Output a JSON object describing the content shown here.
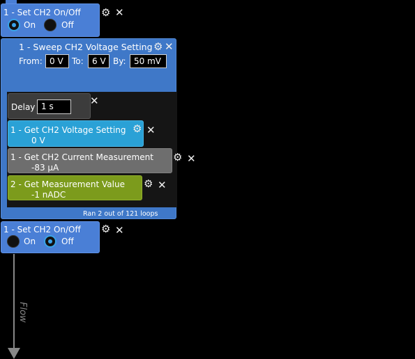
{
  "block1": {
    "title": "1 - Set CH2 On/Off",
    "on_label": "On",
    "off_label": "Off",
    "selected": "On",
    "gear_icon": "gear-icon",
    "close_icon": "close-icon"
  },
  "sweep": {
    "title": "1 - Sweep CH2 Voltage Setting",
    "from_label": "From:",
    "from_value": "0 V",
    "to_label": "To:",
    "to_value": "6 V",
    "by_label": "By:",
    "by_value": "50 mV",
    "status": "Ran 2 out of 121 loops"
  },
  "delay": {
    "label": "Delay",
    "value": "1 s"
  },
  "get_voltage": {
    "title": "1 - Get CH2 Voltage Setting",
    "value": "0 V",
    "color": "#2aa1d6"
  },
  "get_current": {
    "title": "1 - Get CH2 Current Measurement",
    "value": "-83 μA",
    "color": "#6e6e6e"
  },
  "get_measure": {
    "title": "2 - Get Measurement Value",
    "value": "-1 nADC",
    "color": "#7c9b1c"
  },
  "block2": {
    "title": "1 - Set CH2 On/Off",
    "on_label": "On",
    "off_label": "Off",
    "selected": "Off"
  },
  "flow": {
    "label": "Flow",
    "color": "#888888"
  }
}
